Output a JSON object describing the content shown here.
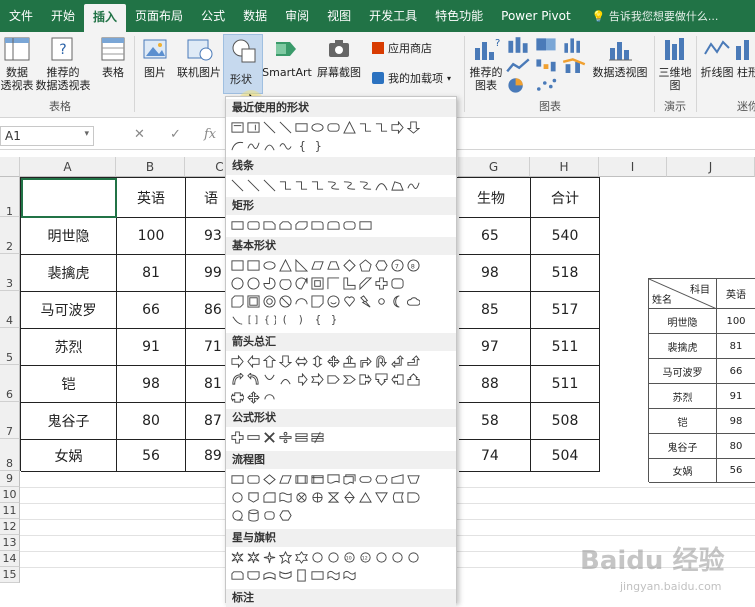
{
  "tabs": [
    "文件",
    "开始",
    "插入",
    "页面布局",
    "公式",
    "数据",
    "审阅",
    "视图",
    "开发工具",
    "特色功能",
    "Power Pivot"
  ],
  "active_tab": "插入",
  "tell_me": "告诉我您想要做什么...",
  "ribbon": {
    "pivot_table": "数据\n透视表",
    "recommended_pivot": "推荐的\n数据透视表",
    "table": "表格",
    "group_tables": "表格",
    "picture": "图片",
    "online_picture": "联机图片",
    "shapes": "形状",
    "smartart": "SmartArt",
    "screenshot": "屏幕截图",
    "app_store": "应用商店",
    "my_addins": "我的加载项",
    "recommended_charts": "推荐的\n图表",
    "pivot_chart": "数据透视图",
    "map_3d": "三维地\n图",
    "line_spark": "折线图",
    "column_spark": "柱形",
    "group_charts": "图表",
    "group_tours": "演示",
    "group_sparklines": "迷你"
  },
  "name_box": "A1",
  "columns": [
    "A",
    "B",
    "C",
    "G",
    "H",
    "I",
    "J"
  ],
  "rows": [
    "1",
    "2",
    "3",
    "4",
    "5",
    "6",
    "7",
    "8",
    "9",
    "10",
    "11",
    "12",
    "13",
    "14",
    "15"
  ],
  "table": {
    "headers": [
      "",
      "英语",
      "语",
      "生物",
      "合计"
    ],
    "rows": [
      {
        "name": "明世隐",
        "english": "100",
        "c": "93",
        "bio": "65",
        "total": "540"
      },
      {
        "name": "裴擒虎",
        "english": "81",
        "c": "99",
        "bio": "98",
        "total": "518"
      },
      {
        "name": "马可波罗",
        "english": "66",
        "c": "86",
        "bio": "85",
        "total": "517"
      },
      {
        "name": "苏烈",
        "english": "91",
        "c": "71",
        "bio": "97",
        "total": "511"
      },
      {
        "name": "铠",
        "english": "98",
        "c": "81",
        "bio": "88",
        "total": "511"
      },
      {
        "name": "鬼谷子",
        "english": "80",
        "c": "87",
        "bio": "58",
        "total": "508"
      },
      {
        "name": "女娲",
        "english": "56",
        "c": "89",
        "bio": "74",
        "total": "504"
      }
    ]
  },
  "small_table": {
    "corner_top": "科目",
    "corner_bottom": "姓名",
    "col": "英语",
    "rows": [
      [
        "明世隐",
        "100"
      ],
      [
        "裴擒虎",
        "81"
      ],
      [
        "马可波罗",
        "66"
      ],
      [
        "苏烈",
        "91"
      ],
      [
        "铠",
        "98"
      ],
      [
        "鬼谷子",
        "80"
      ],
      [
        "女娲",
        "56"
      ]
    ]
  },
  "shapes_menu": {
    "sections": [
      "最近使用的形状",
      "线条",
      "矩形",
      "基本形状",
      "箭头总汇",
      "公式形状",
      "流程图",
      "星与旗帜",
      "标注"
    ]
  },
  "watermark": {
    "text": "Baidu 经验",
    "url": "jingyan.baidu.com"
  }
}
